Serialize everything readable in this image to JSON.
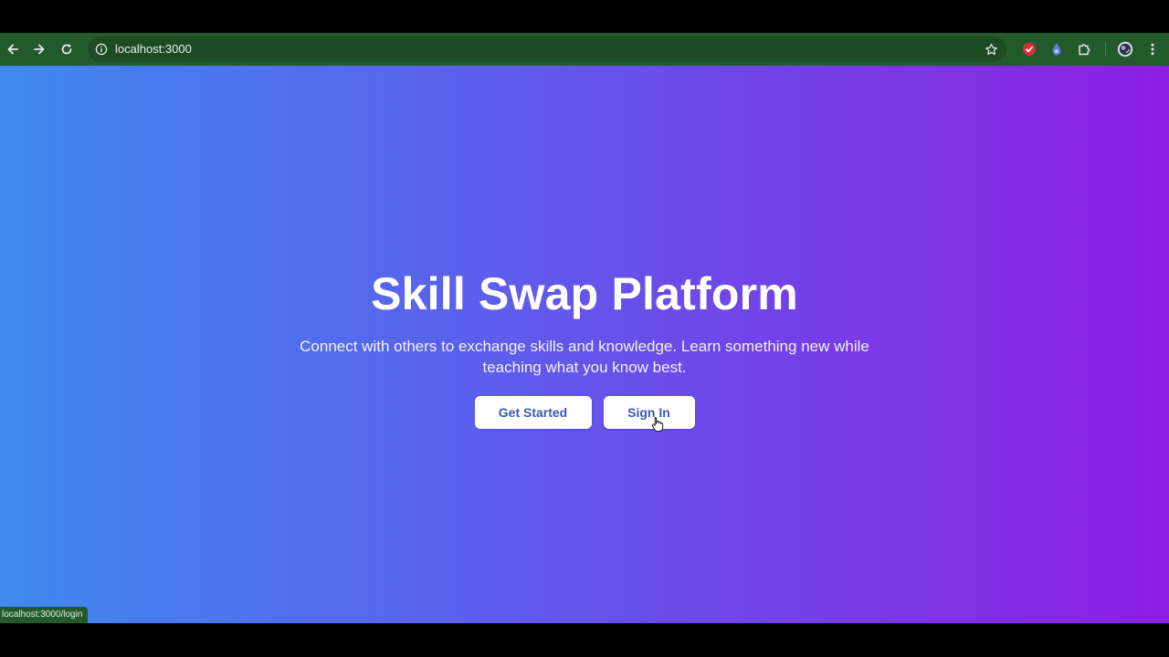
{
  "browser": {
    "url": "localhost:3000",
    "status_url": "localhost:3000/login",
    "icons": {
      "back": "back-arrow-icon",
      "forward": "forward-arrow-icon",
      "reload": "reload-icon",
      "site_info": "info-icon",
      "bookmark": "star-icon",
      "extension_1": "red-shield-extension-icon",
      "extension_2": "blue-extension-icon",
      "extensions": "puzzle-icon",
      "profile": "avatar-icon",
      "menu": "kebab-menu-icon"
    },
    "colors": {
      "toolbar": "#235a2c",
      "omnibox": "#1d4b24"
    }
  },
  "hero": {
    "title": "Skill Swap Platform",
    "subtitle": "Connect with others to exchange skills and knowledge. Learn something new while teaching what you know best.",
    "buttons": {
      "get_started": "Get Started",
      "sign_in": "Sign In"
    },
    "colors": {
      "gradient_start": "#3f89ef",
      "gradient_end": "#8d1ee3",
      "button_text": "#3a57b7"
    }
  }
}
